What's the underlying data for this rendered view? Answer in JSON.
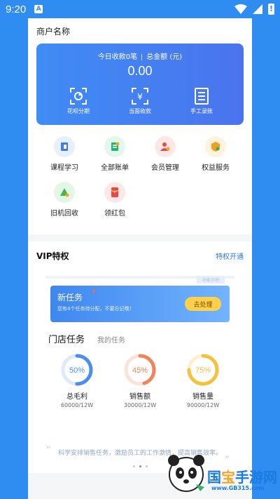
{
  "status_bar": {
    "time": "9:20",
    "notification": "A"
  },
  "header": {
    "merchant_name": "商户名称"
  },
  "banner": {
    "today_label": "今日收款0笔",
    "total_label": "总金额 (元)",
    "amount": "0.00",
    "actions": [
      {
        "label": "花呗分期",
        "icon": "installment-icon"
      },
      {
        "label": "当面收款",
        "icon": "yuan-scan-icon"
      },
      {
        "label": "手工录账",
        "icon": "ledger-icon"
      }
    ]
  },
  "grid": [
    {
      "label": "课程学习",
      "icon": "book-icon",
      "bg": "#e6f0ff",
      "color": "#3a7ef0"
    },
    {
      "label": "全部账单",
      "icon": "bill-icon",
      "bg": "#e4f7ee",
      "color": "#27b36f"
    },
    {
      "label": "会员管理",
      "icon": "member-icon",
      "bg": "#fde8e8",
      "color": "#e5484d"
    },
    {
      "label": "权益服务",
      "icon": "benefit-icon",
      "bg": "#fff3de",
      "color": "#f0a020"
    },
    {
      "label": "旧机回收",
      "icon": "recycle-icon",
      "bg": "#e4f7e6",
      "color": "#3cba55"
    },
    {
      "label": "领红包",
      "icon": "red-packet-icon",
      "bg": "#fde8e8",
      "color": "#e5484d"
    }
  ],
  "vip": {
    "title": "VIP特权",
    "link": "特权开通",
    "tag": "功能示例",
    "task": {
      "title": "新任务",
      "desc": "您有4个任务待分配，不要忘记哦！",
      "button": "去处理"
    },
    "tabs": {
      "active": "门店任务",
      "inactive": "我的任务"
    },
    "rings": [
      {
        "percent": 50,
        "label": "50%",
        "name": "总毛利",
        "sub": "60000/12W",
        "color": "#4a8ff0",
        "track": "#dfe9fb"
      },
      {
        "percent": 45,
        "label": "45%",
        "name": "销售额",
        "sub": "30000/12W",
        "color": "#f0845a",
        "track": "#fbe3da"
      },
      {
        "percent": 75,
        "label": "75%",
        "name": "销售量",
        "sub": "90000/12W",
        "color": "#f5c23d",
        "track": "#fcf0cf"
      }
    ],
    "quote": "科学安排销售任务，激励员工的工作激情，提高销售效率。",
    "quote_open": "“",
    "quote_close": "”"
  },
  "watermark": {
    "brand_a": "国",
    "brand_b": "宝",
    "brand_c": "手游网",
    "url": "www.GB315.com"
  }
}
